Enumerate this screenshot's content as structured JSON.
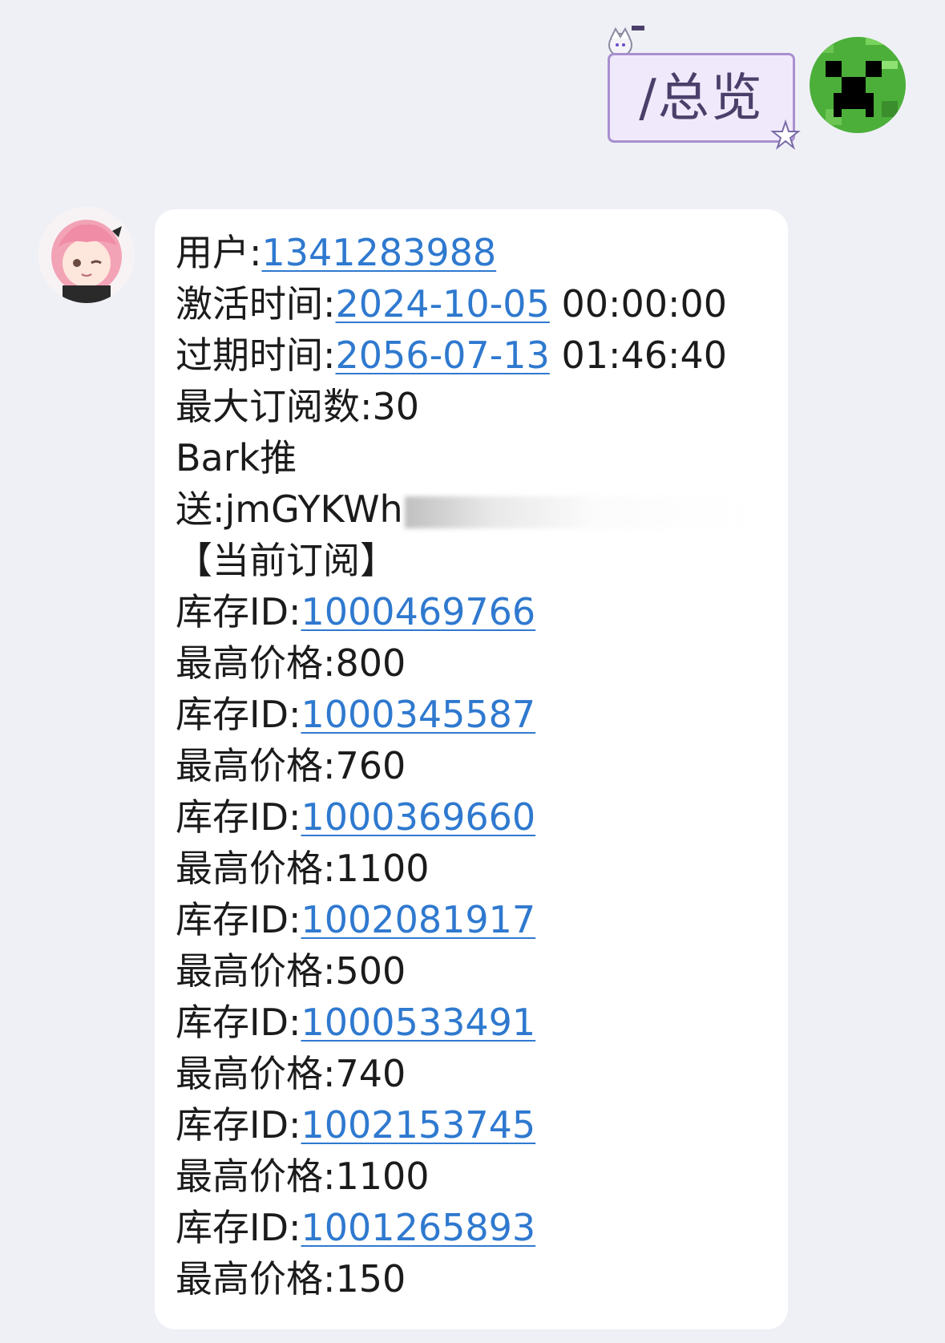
{
  "outgoing": {
    "command": "/总览"
  },
  "incoming": {
    "user_label": "用户:",
    "user_id": "1341283988",
    "activation_label": "激活时间:",
    "activation_date": "2024-10-05",
    "activation_time": "00:00:00",
    "expiry_label": "过期时间:",
    "expiry_date": "2056-07-13",
    "expiry_time": "01:46:40",
    "max_sub_label": "最大订阅数:",
    "max_sub_value": "30",
    "bark_label_1": "Bark推",
    "bark_label_2": "送:",
    "bark_key_visible": "jmGYKWh",
    "subscriptions_header": "【当前订阅】",
    "stock_label": "库存ID:",
    "price_label": "最高价格:",
    "subscriptions": [
      {
        "stock_id": "1000469766",
        "max_price": "800"
      },
      {
        "stock_id": "1000345587",
        "max_price": "760"
      },
      {
        "stock_id": "1000369660",
        "max_price": "1100"
      },
      {
        "stock_id": "1002081917",
        "max_price": "500"
      },
      {
        "stock_id": "1000533491",
        "max_price": "740"
      },
      {
        "stock_id": "1002153745",
        "max_price": "1100"
      },
      {
        "stock_id": "1001265893",
        "max_price": "150"
      }
    ]
  },
  "colors": {
    "background": "#eff0f6",
    "link": "#2f79cf",
    "sticker_border": "#a98fd0",
    "sticker_fill": "#efe9fb",
    "creeper_green": "#4caf3a"
  }
}
